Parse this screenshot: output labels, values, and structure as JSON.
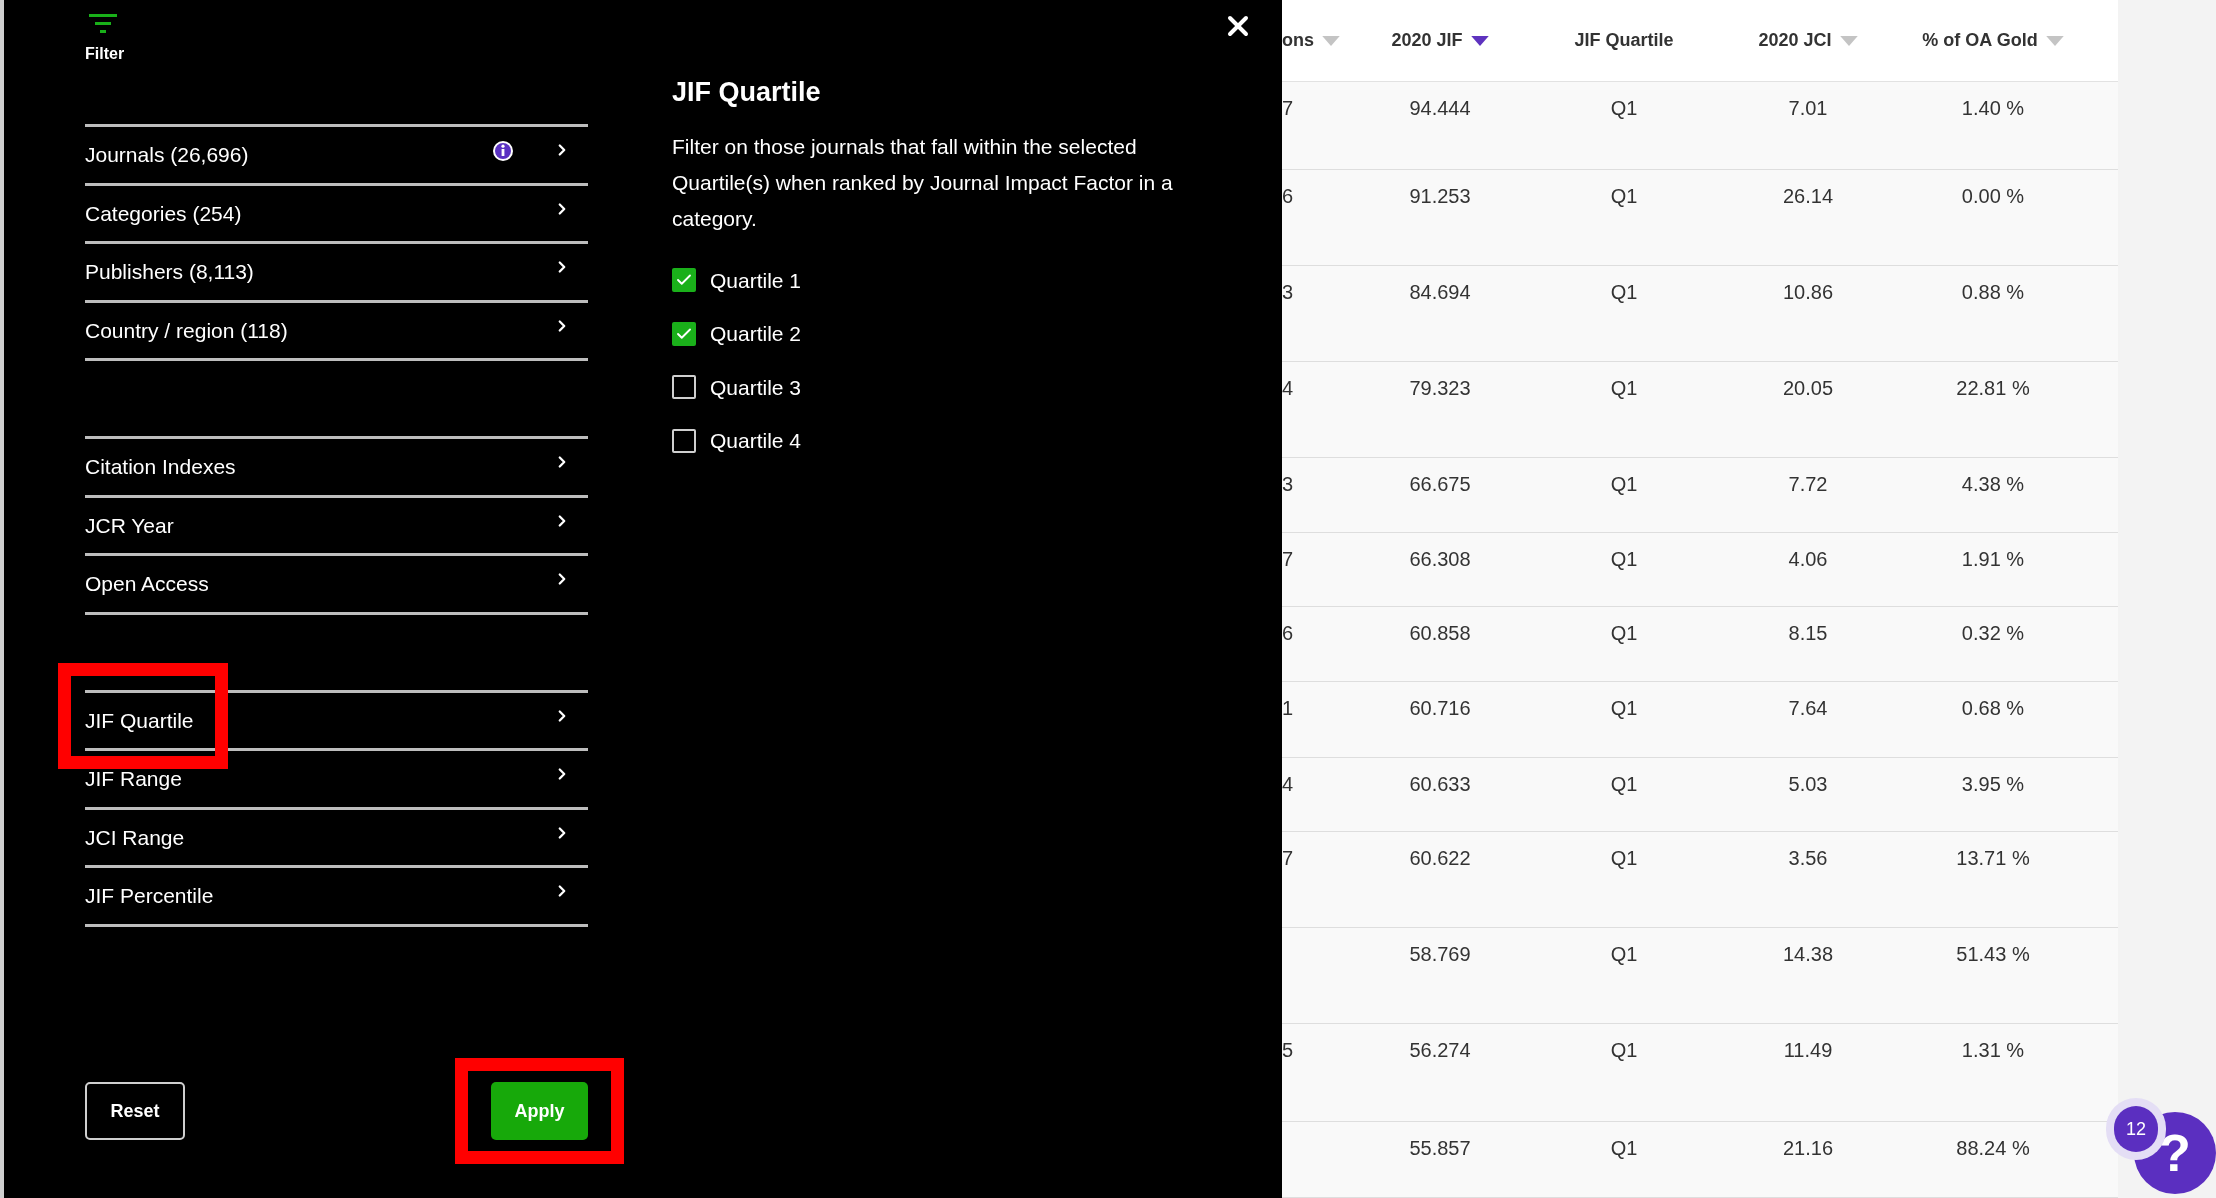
{
  "filter_panel": {
    "header_label": "Filter",
    "groups": [
      [
        {
          "label": "Journals (26,696)",
          "info": true,
          "annotated": false
        },
        {
          "label": "Categories (254)",
          "info": false,
          "annotated": false
        },
        {
          "label": "Publishers (8,113)",
          "info": false,
          "annotated": false
        },
        {
          "label": "Country / region (118)",
          "info": false,
          "annotated": false
        }
      ],
      [
        {
          "label": "Citation Indexes",
          "info": false,
          "annotated": false
        },
        {
          "label": "JCR Year",
          "info": false,
          "annotated": false
        },
        {
          "label": "Open Access",
          "info": false,
          "annotated": false
        }
      ],
      [
        {
          "label": "JIF Quartile",
          "info": false,
          "annotated": true
        },
        {
          "label": "JIF Range",
          "info": false,
          "annotated": false
        },
        {
          "label": "JCI Range",
          "info": false,
          "annotated": false
        },
        {
          "label": "JIF Percentile",
          "info": false,
          "annotated": false
        }
      ]
    ],
    "reset_button": {
      "label": "Reset",
      "annotated": false
    },
    "apply_button": {
      "label": "Apply",
      "annotated": true
    }
  },
  "detail": {
    "title": "JIF Quartile",
    "description": "Filter on those journals that fall within the selected Quartile(s) when ranked by Journal Impact Factor in a category.",
    "options": [
      {
        "label": "Quartile 1",
        "checked": true
      },
      {
        "label": "Quartile 2",
        "checked": true
      },
      {
        "label": "Quartile 3",
        "checked": false
      },
      {
        "label": "Quartile 4",
        "checked": false
      }
    ]
  },
  "table": {
    "columns": [
      {
        "label": "ons",
        "sortable": true,
        "sorted": false
      },
      {
        "label": "2020 JIF",
        "sortable": true,
        "sorted": true
      },
      {
        "label": "JIF Quartile",
        "sortable": false
      },
      {
        "label": "2020 JCI",
        "sortable": true,
        "sorted": false
      },
      {
        "label": "% of OA Gold",
        "sortable": true,
        "sorted": false
      }
    ],
    "rows": [
      [
        "7",
        "94.444",
        "Q1",
        "7.01",
        "1.40 %"
      ],
      [
        "6",
        "91.253",
        "Q1",
        "26.14",
        "0.00 %"
      ],
      [
        "3",
        "84.694",
        "Q1",
        "10.86",
        "0.88 %"
      ],
      [
        "4",
        "79.323",
        "Q1",
        "20.05",
        "22.81 %"
      ],
      [
        "3",
        "66.675",
        "Q1",
        "7.72",
        "4.38 %"
      ],
      [
        "7",
        "66.308",
        "Q1",
        "4.06",
        "1.91 %"
      ],
      [
        "6",
        "60.858",
        "Q1",
        "8.15",
        "0.32 %"
      ],
      [
        "1",
        "60.716",
        "Q1",
        "7.64",
        "0.68 %"
      ],
      [
        "4",
        "60.633",
        "Q1",
        "5.03",
        "3.95 %"
      ],
      [
        "7",
        "60.622",
        "Q1",
        "3.56",
        "13.71 %"
      ],
      [
        "",
        "58.769",
        "Q1",
        "14.38",
        "51.43 %"
      ],
      [
        "5",
        "56.274",
        "Q1",
        "11.49",
        "1.31 %"
      ],
      [
        "",
        "55.857",
        "Q1",
        "21.16",
        "88.24 %"
      ]
    ]
  },
  "help": {
    "label": "?",
    "badge": "12"
  }
}
